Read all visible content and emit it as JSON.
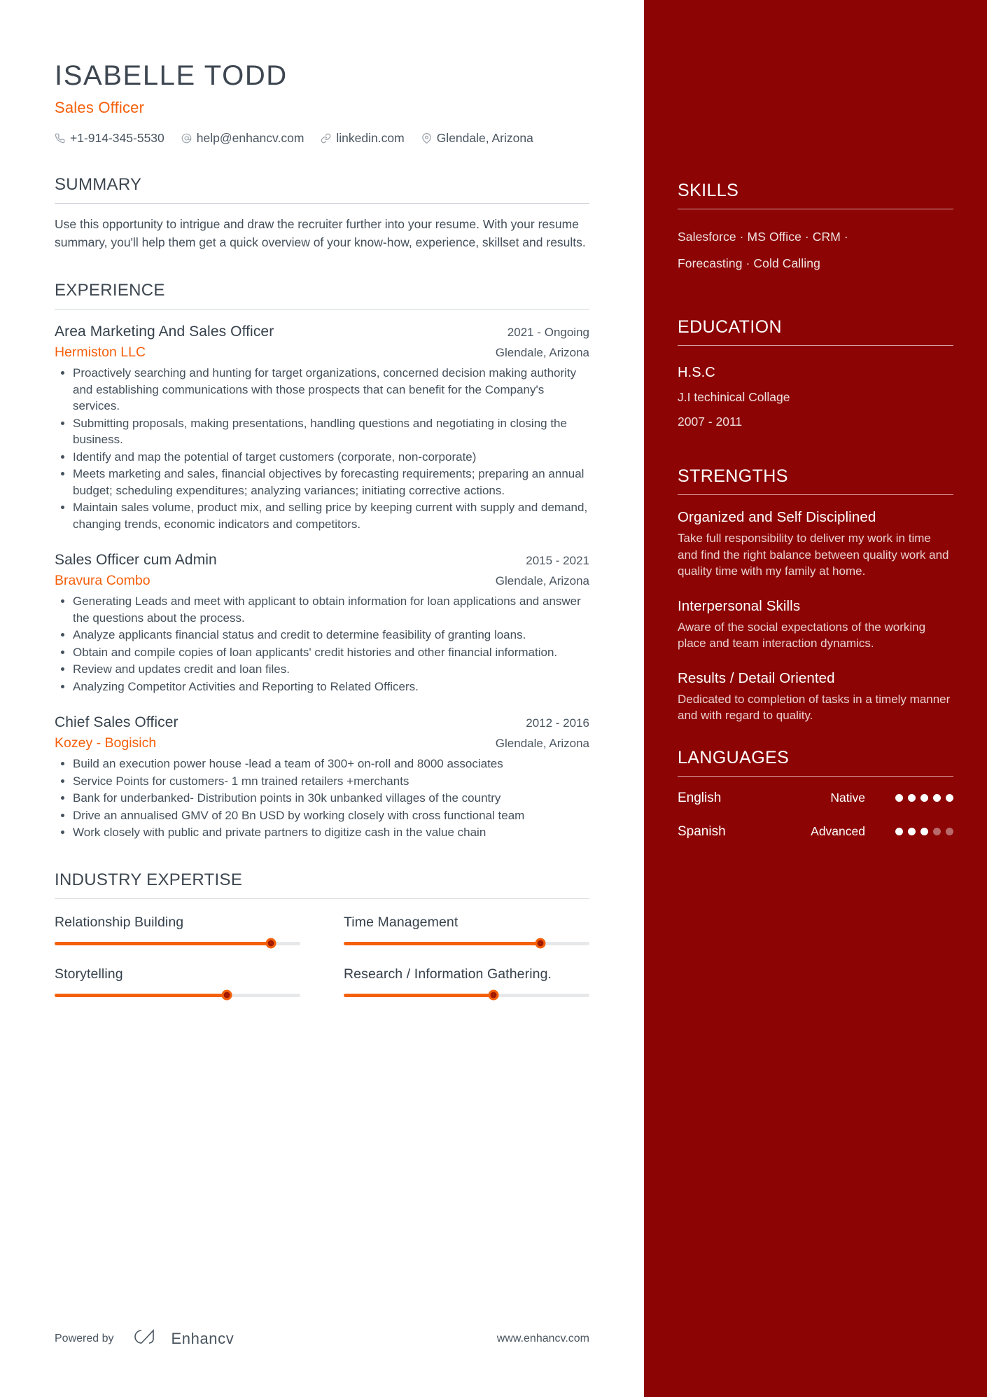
{
  "theme": {
    "accent": "#f4600c",
    "sidebar_bg": "#8c0404",
    "heading": "#3e4751",
    "body_text": "#44505b"
  },
  "header": {
    "name": "ISABELLE TODD",
    "job_title": "Sales Officer",
    "contacts": [
      {
        "icon": "phone-icon",
        "text": "+1-914-345-5530"
      },
      {
        "icon": "email-icon",
        "text": "help@enhancv.com"
      },
      {
        "icon": "link-icon",
        "text": "linkedin.com"
      },
      {
        "icon": "location-pin-icon",
        "text": "Glendale, Arizona"
      }
    ]
  },
  "summary": {
    "heading": "SUMMARY",
    "text": "Use this opportunity to intrigue and draw the recruiter further into your resume. With your resume summary, you'll help them get a quick overview of your know-how, experience, skillset and results."
  },
  "experience": {
    "heading": "EXPERIENCE",
    "entries": [
      {
        "role": "Area Marketing And Sales Officer",
        "date": "2021 - Ongoing",
        "company": "Hermiston LLC",
        "location": "Glendale, Arizona",
        "bullets": [
          "Proactively searching and hunting for target organizations, concerned decision making authority and establishing communications with those prospects that can benefit for the Company's services.",
          "Submitting proposals, making presentations, handling questions and negotiating in closing the business.",
          "Identify and map the potential of target customers (corporate, non-corporate)",
          "Meets marketing and sales, financial objectives by forecasting requirements; preparing an annual budget; scheduling expenditures; analyzing variances; initiating corrective actions.",
          "Maintain sales volume, product mix, and selling price by keeping current with supply and demand, changing trends, economic indicators and competitors."
        ]
      },
      {
        "role": "Sales Officer cum Admin",
        "date": "2015 - 2021",
        "company": "Bravura Combo",
        "location": "Glendale, Arizona",
        "bullets": [
          "Generating Leads and meet with applicant to obtain information for loan applications and answer the questions about the process.",
          "Analyze applicants financial status and credit to determine feasibility of granting loans.",
          "Obtain and compile copies of loan applicants' credit histories and other financial information.",
          "Review and updates credit and loan files.",
          "Analyzing Competitor Activities and Reporting to Related Officers."
        ]
      },
      {
        "role": "Chief Sales Officer",
        "date": "2012 - 2016",
        "company": "Kozey - Bogisich",
        "location": "Glendale, Arizona",
        "bullets": [
          "Build an execution power house -lead a team of 300+ on-roll and 8000 associates",
          "Service Points for customers- 1 mn trained retailers +merchants",
          " Bank for underbanked- Distribution points in 30k unbanked villages of the country",
          "Drive an annualised GMV of 20 Bn USD by working closely with cross functional team",
          " Work closely with public and private partners to digitize cash in the value chain"
        ]
      }
    ]
  },
  "industry_expertise": {
    "heading": "INDUSTRY EXPERTISE",
    "items": [
      {
        "label": "Relationship Building",
        "percent": 88
      },
      {
        "label": "Time Management",
        "percent": 80
      },
      {
        "label": "Storytelling",
        "percent": 70
      },
      {
        "label": "Research / Information Gathering.",
        "percent": 61
      }
    ]
  },
  "sidebar": {
    "skills": {
      "heading": "SKILLS",
      "lines": [
        "Salesforce · MS Office · CRM ·",
        "Forecasting · Cold Calling"
      ]
    },
    "education": {
      "heading": "EDUCATION",
      "entries": [
        {
          "degree": "H.S.C",
          "school": "J.I techinical Collage",
          "date": "2007 - 2011"
        }
      ]
    },
    "strengths": {
      "heading": "STRENGTHS",
      "items": [
        {
          "title": "Organized and Self Disciplined",
          "desc": "Take full responsibility to deliver my work in time and find the right balance between quality work and quality time with my family at home."
        },
        {
          "title": "Interpersonal Skills",
          "desc": "Aware of the social expectations of the working place and team interaction dynamics."
        },
        {
          "title": "Results / Detail Oriented",
          "desc": "Dedicated to completion of tasks in a timely manner and with regard to quality."
        }
      ]
    },
    "languages": {
      "heading": "LANGUAGES",
      "items": [
        {
          "name": "English",
          "level": "Native",
          "filled": 5,
          "total": 5
        },
        {
          "name": "Spanish",
          "level": "Advanced",
          "filled": 3,
          "total": 5
        }
      ]
    }
  },
  "footer": {
    "powered_by": "Powered by",
    "brand": "Enhancv",
    "website": "www.enhancv.com"
  }
}
